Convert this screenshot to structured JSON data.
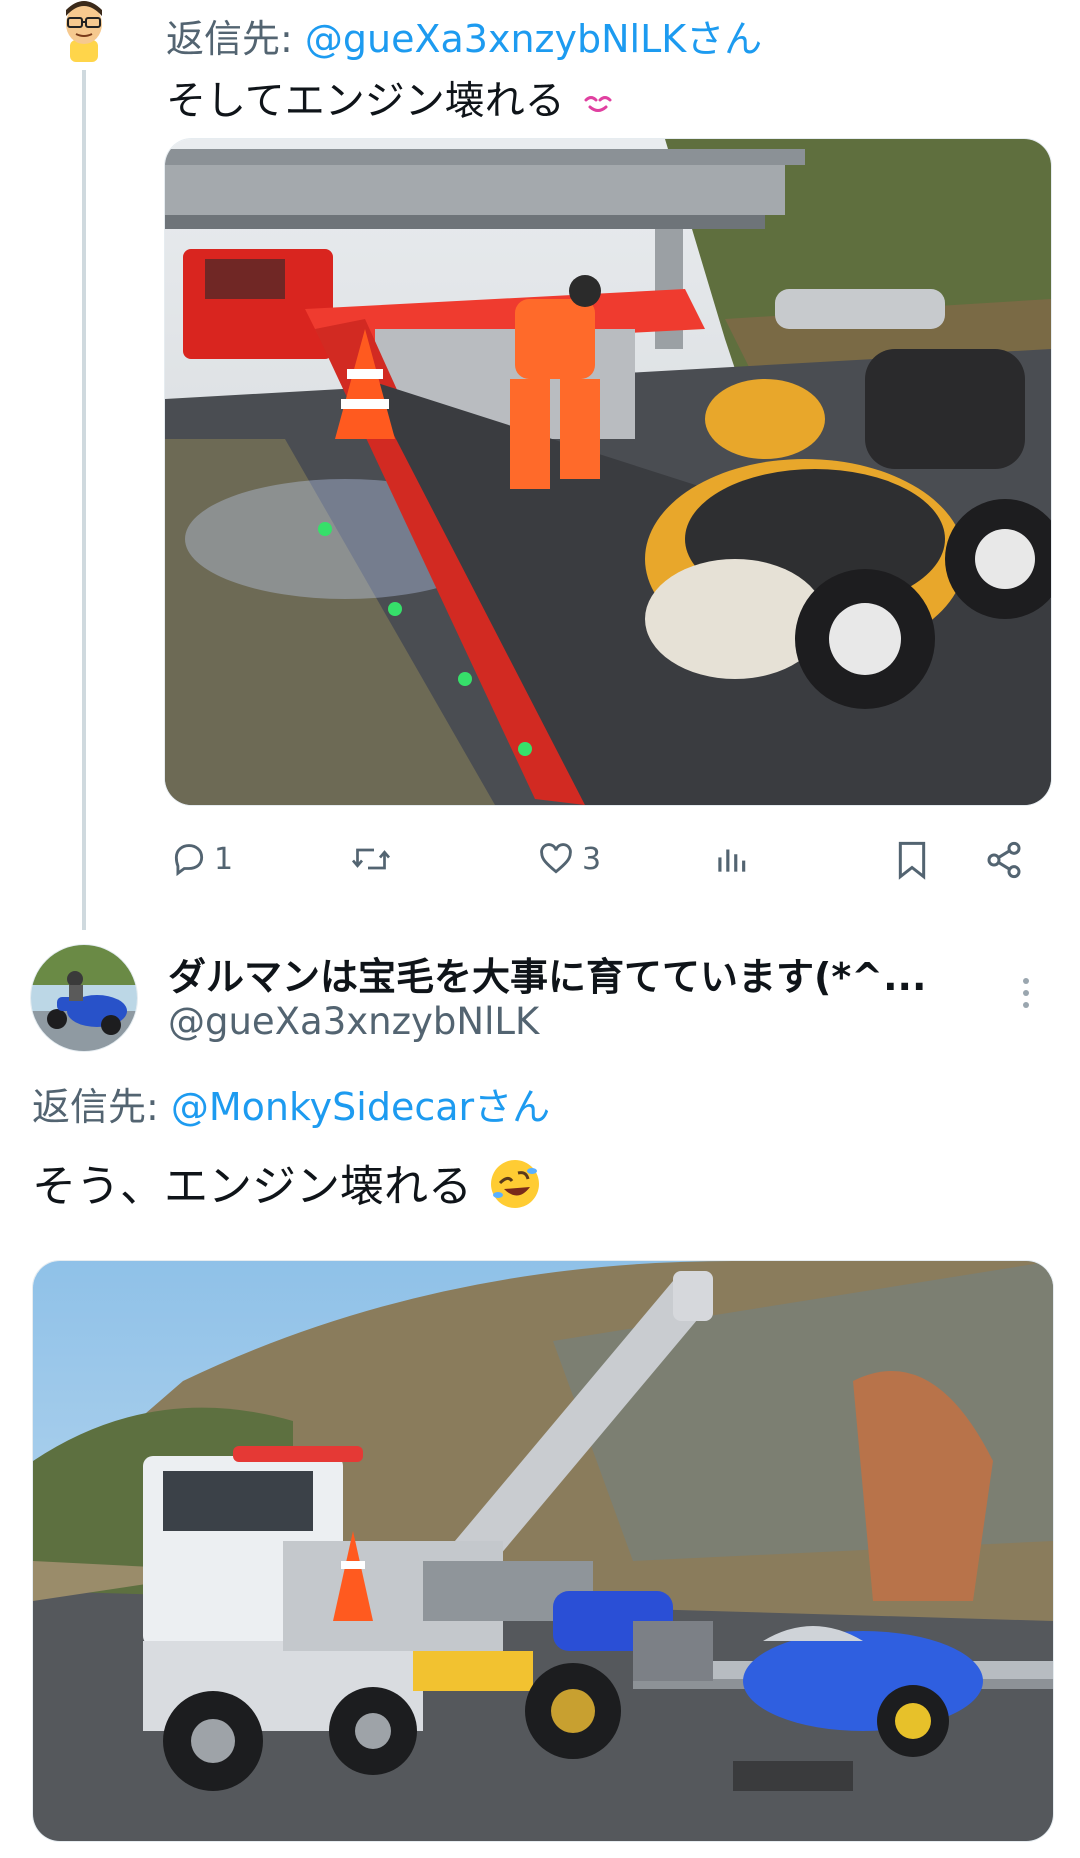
{
  "post1": {
    "reply_prefix": "返信先: ",
    "reply_handle": "@gueXa3xnzybNlLKさん",
    "text": "そしてエンジン壊れる",
    "text_emoji": "smiling-face-emoji",
    "avatar_icon": "cartoon-avatar-icon",
    "image_alt": "tow-truck-photo",
    "actions": {
      "reply_count": "1",
      "retweet_count": "",
      "like_count": "3",
      "views_count": ""
    }
  },
  "post2": {
    "display_name": "ダルマンは宝毛を大事に育てています(*^...",
    "username": "@gueXa3xnzybNlLK",
    "reply_prefix": "返信先: ",
    "reply_handle": "@MonkySidecarさん",
    "text": "そう、エンジン壊れる",
    "text_emoji": "rofl-emoji",
    "avatar_icon": "motorcycle-avatar-icon",
    "image_alt": "tow-truck-sidecar-photo"
  },
  "colors": {
    "link": "#1d9bf0",
    "muted": "#536471",
    "text": "#0f1419",
    "thread_line": "#cfd9de"
  }
}
